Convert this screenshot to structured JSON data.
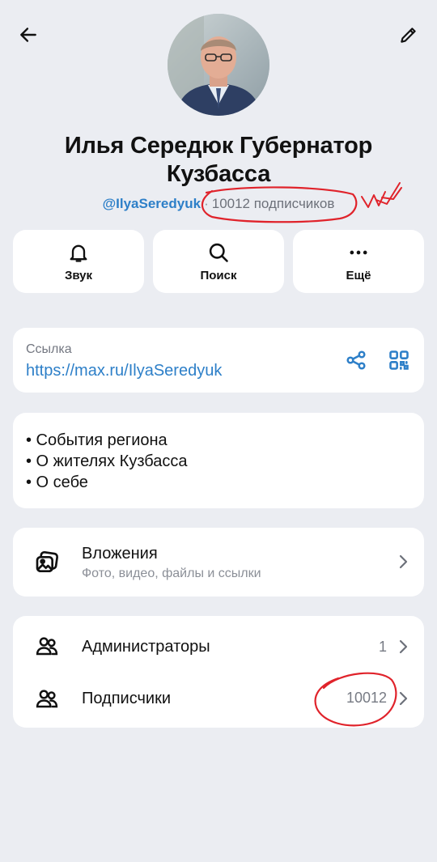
{
  "header": {
    "back_icon": "arrow-left-icon",
    "edit_icon": "pencil-icon"
  },
  "profile": {
    "title": "Илья Середюк Губернатор Кузбасса",
    "handle": "@IlyaSeredyuk",
    "separator": "·",
    "subscribers_text": "10012 подписчиков"
  },
  "actions": [
    {
      "label": "Звук",
      "icon": "bell-icon"
    },
    {
      "label": "Поиск",
      "icon": "search-icon"
    },
    {
      "label": "Ещё",
      "icon": "more-dots-icon"
    }
  ],
  "link": {
    "caption": "Ссылка",
    "url": "https://max.ru/IlyaSeredyuk",
    "share_icon": "share-icon",
    "qr_icon": "qr-code-icon"
  },
  "description": {
    "text": "• События региона\n• О жителях Кузбасса\n• О себе"
  },
  "attachments": {
    "title": "Вложения",
    "subtitle": "Фото, видео, файлы и ссылки",
    "icon": "gallery-icon"
  },
  "people": {
    "admins": {
      "label": "Администраторы",
      "count": "1",
      "icon": "users-icon"
    },
    "subscribers": {
      "label": "Подписчики",
      "count": "10012",
      "icon": "users-icon"
    }
  },
  "colors": {
    "background": "#ebedf2",
    "card": "#ffffff",
    "accent": "#2d7fc8",
    "annotation": "#e0232b"
  }
}
